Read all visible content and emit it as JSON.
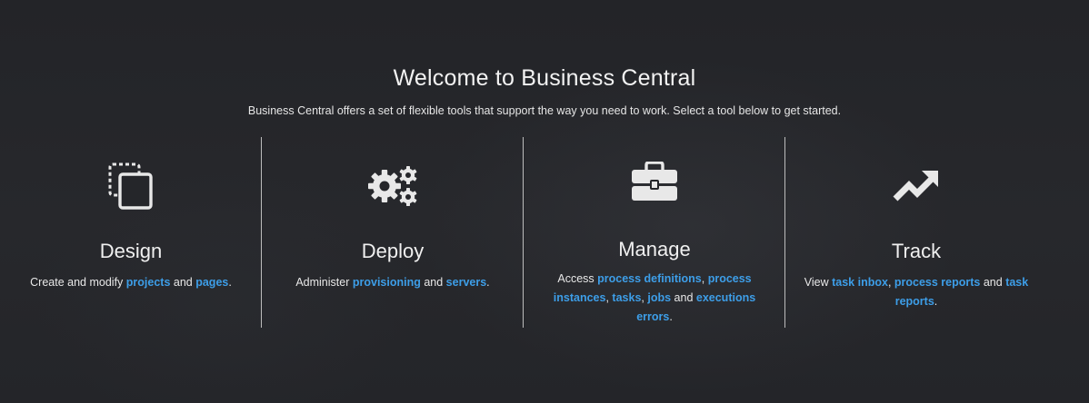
{
  "welcome": {
    "title": "Welcome to Business Central",
    "subtitle": "Business Central offers a set of flexible tools that support the way you need to work. Select a tool below to get started."
  },
  "tiles": [
    {
      "heading": "Design",
      "icon": "copy-icon",
      "text": {
        "prefix": "Create and modify ",
        "link_projects": "projects",
        "sep_and": " and ",
        "link_pages": "pages",
        "end": "."
      }
    },
    {
      "heading": "Deploy",
      "icon": "gears-icon",
      "text": {
        "prefix": "Administer ",
        "link_provisioning": "provisioning",
        "sep_and": " and ",
        "link_servers": "servers",
        "end": "."
      }
    },
    {
      "heading": "Manage",
      "icon": "briefcase-icon",
      "text": {
        "prefix": "Access ",
        "link_process_definitions": "process definitions",
        "sep1": ", ",
        "link_process_instances": "process instances",
        "sep2": ", ",
        "link_tasks": "tasks",
        "sep3": ", ",
        "link_jobs": "jobs",
        "sep_and": " and ",
        "link_executions_errors": "executions errors",
        "end": "."
      }
    },
    {
      "heading": "Track",
      "icon": "trend-up-icon",
      "text": {
        "prefix": "View ",
        "link_task_inbox": "task inbox",
        "sep1": ", ",
        "link_process_reports": "process reports",
        "sep_and": " and ",
        "link_task_reports": "task reports",
        "end": "."
      }
    }
  ],
  "colors": {
    "background": "#26272b",
    "link": "#3d9ee8",
    "text": "#ececec",
    "icon": "#e8e8e8"
  }
}
